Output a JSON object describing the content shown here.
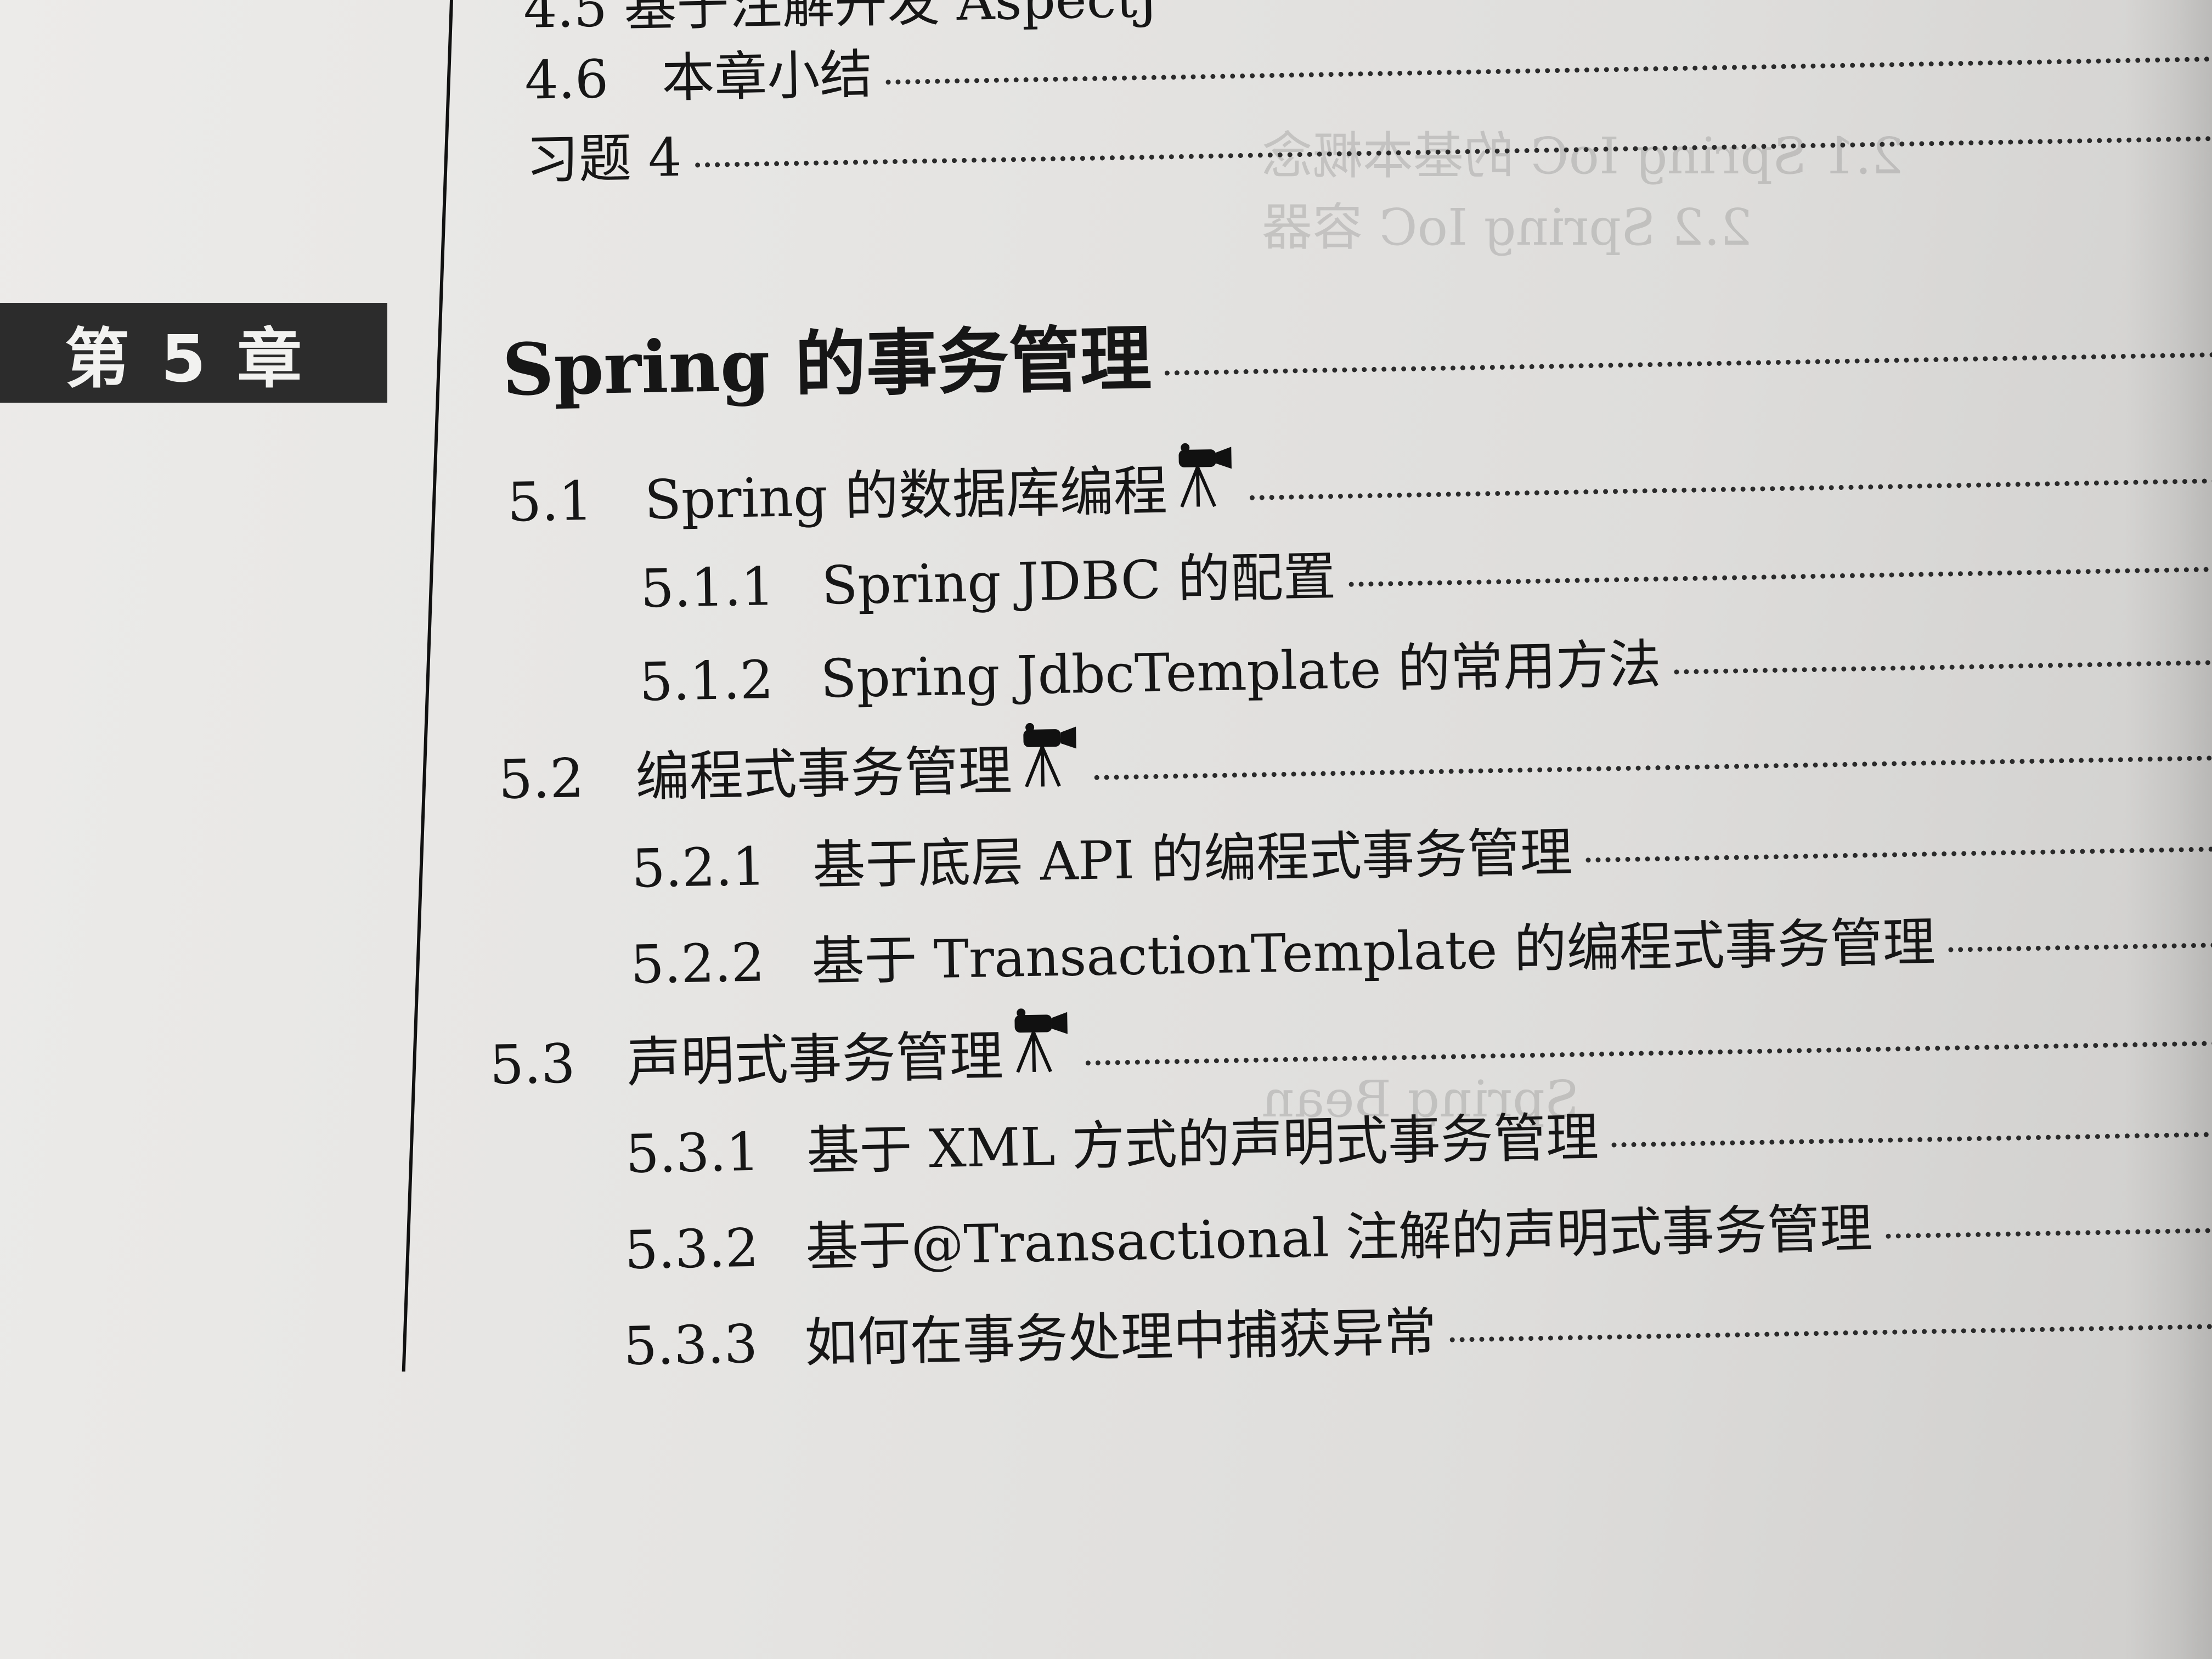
{
  "chapter": {
    "label": "第 5 章",
    "title": "Spring 的事务管理"
  },
  "prev_section": {
    "partial_top": "4.5 基于注解开发 AspectJ",
    "items": [
      {
        "num": "4.6",
        "title": "本章小结"
      },
      {
        "num": "",
        "title": "习题 4"
      }
    ]
  },
  "sections": [
    {
      "num": "5.1",
      "title": "Spring 的数据库编程",
      "video": true
    },
    {
      "num": "5.1.1",
      "title": "Spring JDBC 的配置",
      "video": false
    },
    {
      "num": "5.1.2",
      "title": "Spring JdbcTemplate 的常用方法",
      "video": false
    },
    {
      "num": "5.2",
      "title": "编程式事务管理",
      "video": true
    },
    {
      "num": "5.2.1",
      "title": "基于底层 API 的编程式事务管理",
      "video": false
    },
    {
      "num": "5.2.2",
      "title": "基于 TransactionTemplate 的编程式事务管理",
      "video": false
    },
    {
      "num": "5.3",
      "title": "声明式事务管理",
      "video": true
    },
    {
      "num": "5.3.1",
      "title": "基于 XML 方式的声明式事务管理",
      "video": false
    },
    {
      "num": "5.3.2",
      "title": "基于@Transactional 注解的声明式事务管理",
      "video": false
    },
    {
      "num": "5.3.3",
      "title": "如何在事务处理中捕获异常",
      "video": false
    }
  ],
  "icons": {
    "video": "video-camera-icon"
  }
}
